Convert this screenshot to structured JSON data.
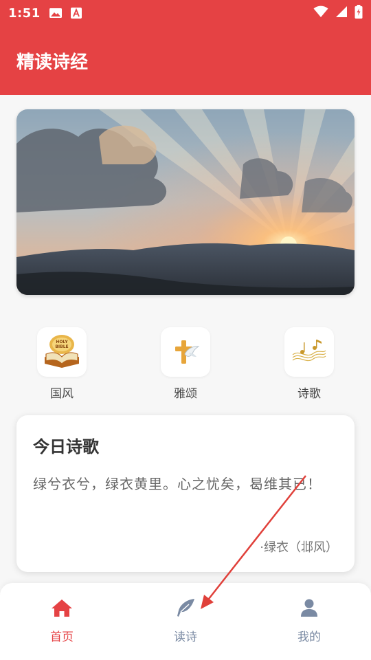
{
  "status_bar": {
    "time": "1:51",
    "icons": [
      "image-icon",
      "text-a-icon",
      "wifi-icon",
      "signal-icon",
      "battery-charging-icon"
    ]
  },
  "app_bar": {
    "title": "精读诗经"
  },
  "banner": {
    "icon": "sunrise-banner-image"
  },
  "categories": [
    {
      "label": "国风",
      "icon": "bible-book-icon"
    },
    {
      "label": "雅颂",
      "icon": "cross-dove-icon"
    },
    {
      "label": "诗歌",
      "icon": "music-notes-icon"
    }
  ],
  "daily_poem": {
    "title": "今日诗歌",
    "text": "绿兮衣兮，绿衣黄里。心之忧矣，曷维其已！",
    "source": "·绿衣（邶风）"
  },
  "tab_bar": {
    "tabs": [
      {
        "label": "首页",
        "icon": "home-icon",
        "active": true
      },
      {
        "label": "读诗",
        "icon": "feather-icon",
        "active": false
      },
      {
        "label": "我的",
        "icon": "person-icon",
        "active": false
      }
    ]
  },
  "colors": {
    "primary": "#e54244",
    "tab_inactive": "#7a8aa3",
    "text_dark": "#333333",
    "text_muted": "#666666"
  }
}
